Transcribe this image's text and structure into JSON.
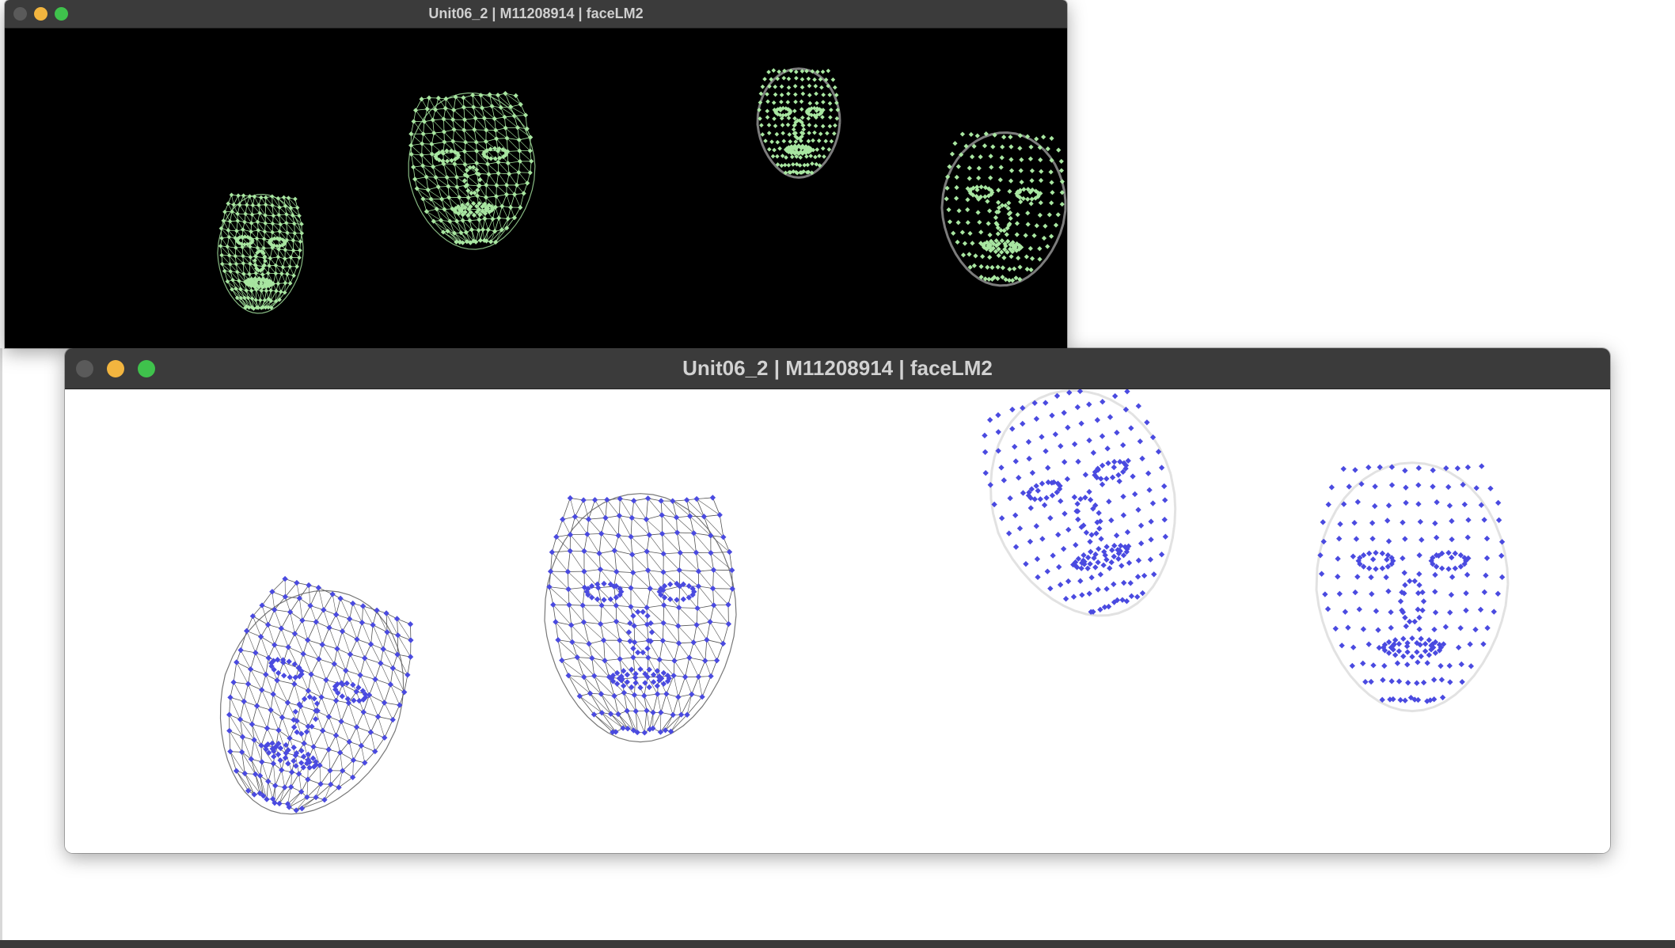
{
  "windows": {
    "back": {
      "title": "Unit06_2 | M11208914 | faceLM2",
      "canvas_background": "#000000",
      "landmark_color": "#a8e6a1"
    },
    "front": {
      "title": "Unit06_2 | M11208914 | faceLM2",
      "canvas_background": "#ffffff",
      "landmark_color": "#4a4ae0",
      "mesh_color": "#555555"
    }
  },
  "icons": {
    "close": "close-icon",
    "minimize": "minimize-icon",
    "zoom": "zoom-icon",
    "face_mesh": "face-mesh-icon",
    "face_points": "face-points-icon"
  }
}
